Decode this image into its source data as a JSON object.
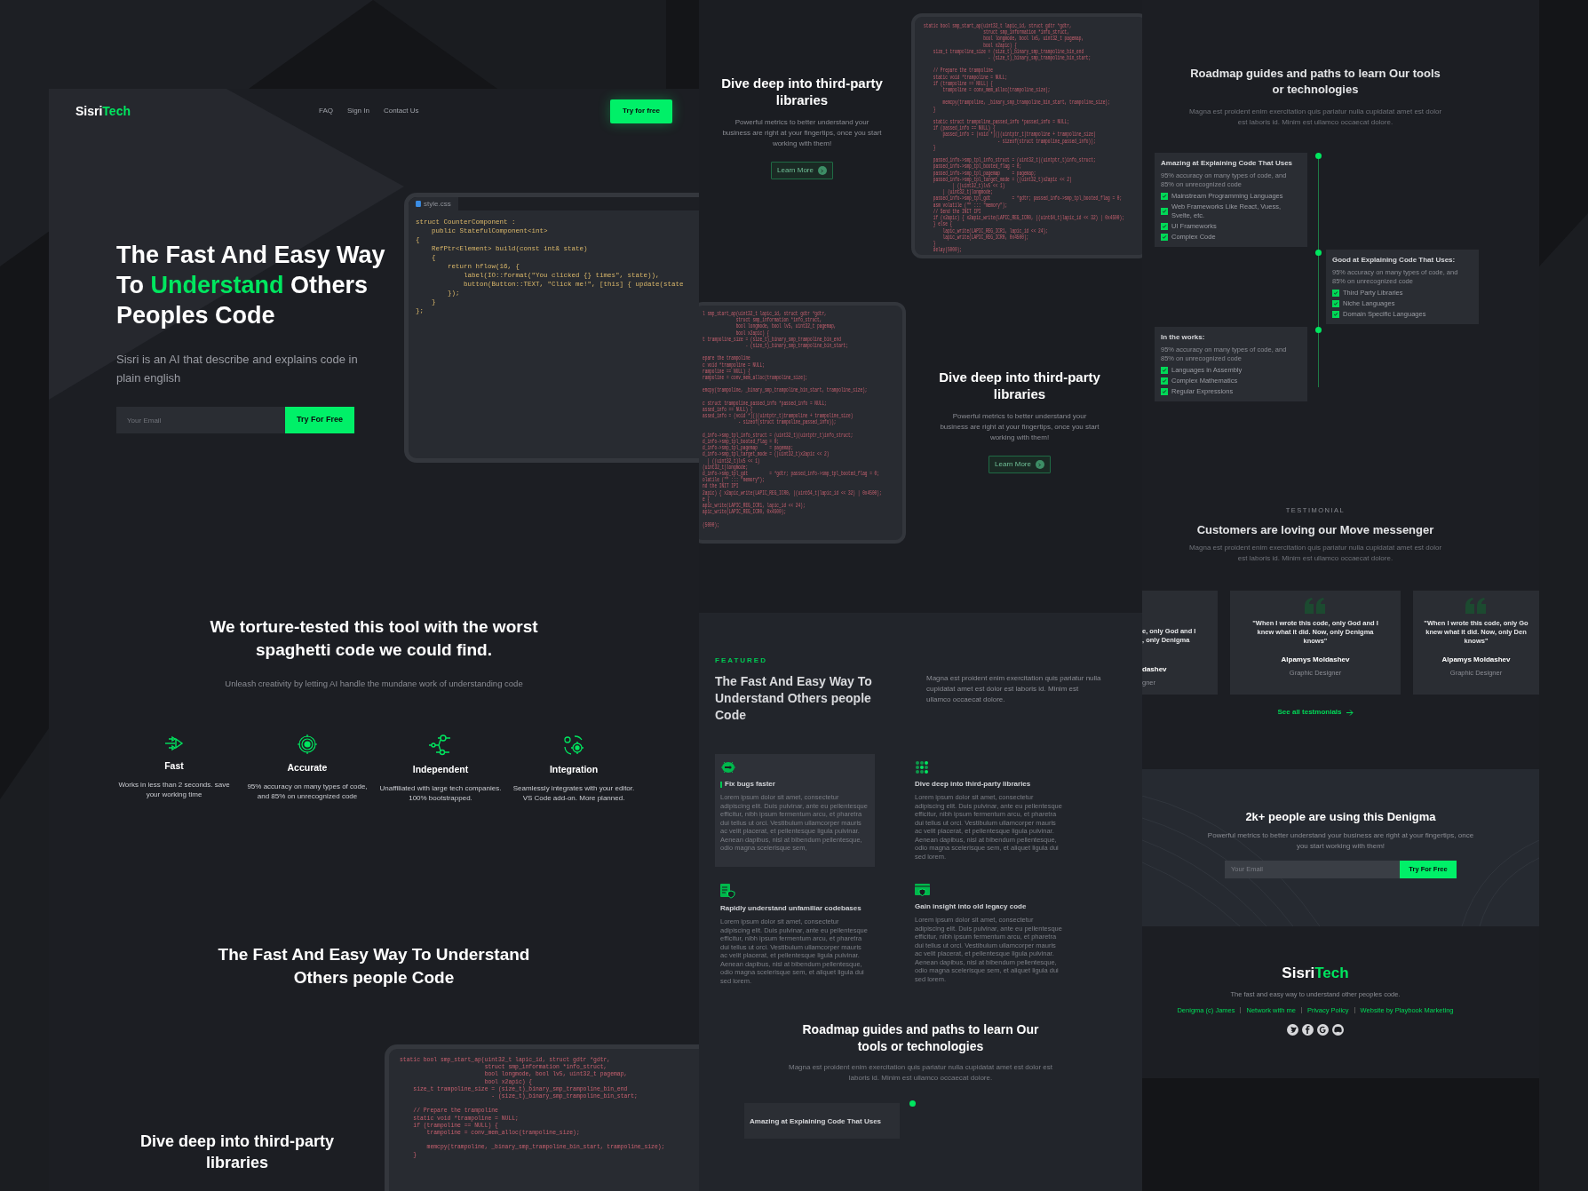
{
  "nav": {
    "logo": [
      {
        "text": "Sisri",
        "accent": false
      },
      {
        "text": "Tech",
        "accent": true
      }
    ],
    "links": [
      "FAQ",
      "Sign In",
      "Contact Us"
    ],
    "cta": "Try for free"
  },
  "hero": {
    "title_lines": [
      [
        {
          "text": "The Fast And Easy Way",
          "accent": false
        }
      ],
      [
        {
          "text": "To ",
          "accent": false
        },
        {
          "text": "Understand",
          "accent": true
        },
        {
          "text": " Others",
          "accent": false
        }
      ],
      [
        {
          "text": "Peoples Code",
          "accent": false
        }
      ]
    ],
    "subtitle": "Sisri is an AI that describe and explains code in plain english",
    "placeholder": "Your Email",
    "button": "Try For Free",
    "editor": {
      "tab": "style.css",
      "code": [
        "struct CounterComponent :",
        "    public StatefulComponent<int>",
        "{",
        "    RefPtr<Element> build(const int& state)",
        "    {",
        "        return hflow(16, {",
        "            label(IO::format(\"You clicked {} times\", state)),",
        "            button(Button::TEXT, \"Click me!\", [this] { update(state",
        "        });",
        "    }",
        "};"
      ]
    }
  },
  "torture": {
    "heading": "We torture-tested this tool with the worst spaghetti code we could find.",
    "subheading": "Unleash creativity by letting AI handle the mundane work of understanding code",
    "features": [
      {
        "kind": "fast",
        "title": "Fast",
        "text": "Works in less than 2 seconds. save your working time"
      },
      {
        "kind": "accurate",
        "title": "Accurate",
        "text": "95% accuracy on many types of code, and 85% on unrecognized code"
      },
      {
        "kind": "independent",
        "title": "Independent",
        "text": "Unaffiliated with large tech companies. 100% bootstrapped."
      },
      {
        "kind": "integration",
        "title": "Integration",
        "text": "Seamlessly integrates with your editor. VS Code add-on. More planned."
      }
    ]
  },
  "way": {
    "heading": "The Fast And Easy Way To Understand Others people Code"
  },
  "dive_left": {
    "heading": "Dive deep into third-party libraries",
    "code_blocks": [
      [
        "static bool smp_start_ap(uint32_t lapic_id, struct gdtr *gdtr,",
        "                         struct smp_information *info_struct,",
        "                         bool longmode, bool lv5, uint32_t pagemap,",
        "                         bool x2apic) {",
        "    size_t trampoline_size = (size_t)_binary_smp_trampoline_bin_end",
        "                           - (size_t)_binary_smp_trampoline_bin_start;"
      ],
      [
        "    // Prepare the trampoline",
        "    static void *trampoline = NULL;",
        "    if (trampoline == NULL) {",
        "        trampoline = conv_mem_alloc(trampoline_size);"
      ],
      [
        "        memcpy(trampoline, _binary_smp_trampoline_bin_start, trampoline_size);",
        "    }"
      ]
    ]
  },
  "middle_sections": [
    {
      "heading": "Dive deep into third-party libraries",
      "text": "Powerful metrics to better understand your business are right at your fingertips, once you start working with them!",
      "button": "Learn More",
      "code_blocks": [
        [
          "static bool smp_start_ap(uint32_t lapic_id, struct gdtr *gdtr,",
          "                         struct smp_information *info_struct,",
          "                         bool longmode, bool lv5, uint32_t pagemap,",
          "                         bool x2apic) {",
          "    size_t trampoline_size = (size_t)_binary_smp_trampoline_bin_end",
          "                           - (size_t)_binary_smp_trampoline_bin_start;"
        ],
        [
          "    // Prepare the trampoline",
          "    static void *trampoline = NULL;",
          "    if (trampoline == NULL) {",
          "        trampoline = conv_mem_alloc(trampoline_size);"
        ],
        [
          "        memcpy(trampoline, _binary_smp_trampoline_bin_start, trampoline_size);",
          "    }"
        ],
        [
          "    static struct trampoline_passed_info *passed_info = NULL;",
          "    if (passed_info == NULL) {",
          "        passed_info = (void *)(((uintptr_t)trampoline + trampoline_size)",
          "                               - sizeof(struct trampoline_passed_info));",
          "    }"
        ],
        [
          "    passed_info->smp_tpl_info_struct = (uint32_t)(uintptr_t)info_struct;",
          "    passed_info->smp_tpl_booted_flag = 0;",
          "    passed_info->smp_tpl_pagemap     = pagemap;",
          "    passed_info->smp_tpl_target_mode = ((uint32_t)x2apic << 2)",
          "            | ((uint32_t)lv5 << 1)",
          "        | (uint32_t)longmode;",
          "    passed_info->smp_tpl_gdt         = *gdtr; passed_info->smp_tpl_booted_flag = 0;",
          "    asm volatile (\"\" ::: \"memory\");",
          "    // Send the INIT IPI",
          "    if (x2apic) { x2apic_write(LAPIC_REG_ICR0, ((uint64_t)lapic_id << 32) | 0x4500);",
          "    } else {",
          "        lapic_write(LAPIC_REG_ICR1, lapic_id << 24);",
          "        lapic_write(LAPIC_REG_ICR0, 0x4500);",
          "    }",
          "    delay(5000);"
        ]
      ]
    },
    {
      "heading": "Dive deep into third-party libraries",
      "text": "Powerful metrics to better understand your business are right at your fingertips, once you start working with them!",
      "button": "Learn More",
      "code_blocks": [
        [
          "l smp_start_ap(uint32_t lapic_id, struct gdtr *gdtr,",
          "              struct smp_information *info_struct,",
          "              bool longmode, bool lv5, uint32_t pagemap,",
          "              bool x2apic) {",
          "t trampoline_size = (size_t)_binary_smp_trampoline_bin_end",
          "                  - (size_t)_binary_smp_trampoline_bin_start;"
        ],
        [
          "epare the trampoline",
          "c void *trampoline = NULL;",
          "rampoline == NULL) {",
          "rampoline = conv_mem_alloc(trampoline_size);"
        ],
        [
          "emcpy(trampoline, _binary_smp_trampoline_bin_start, trampoline_size);"
        ],
        [
          "c struct trampoline_passed_info *passed_info = NULL;",
          "assed_info == NULL) {",
          "assed_info = (void *)(((uintptr_t)trampoline + trampoline_size)",
          "               - sizeof(struct trampoline_passed_info));"
        ],
        [
          "d_info->smp_tpl_info_struct = (uint32_t)(uintptr_t)info_struct;",
          "d_info->smp_tpl_booted_flag = 0;",
          "d_info->smp_tpl_pagemap     = pagemap;",
          "d_info->smp_tpl_target_mode = ((uint32_t)x2apic << 2)",
          "  | ((uint32_t)lv5 << 1)",
          "(uint32_t)longmode;",
          "d_info->smp_tpl_gdt         = *gdtr; passed_info->smp_tpl_booted_flag = 0;",
          "olatile (\"\" ::: \"memory\");",
          "nd the INIT IPI",
          "2apic) { x2apic_write(LAPIC_REG_ICR0, ((uint64_t)lapic_id << 32) | 0x4500);",
          "e {",
          "apic_write(LAPIC_REG_ICR1, lapic_id << 24);",
          "apic_write(LAPIC_REG_ICR0, 0x4500);"
        ],
        [
          "(5000);"
        ]
      ]
    }
  ],
  "featured": {
    "label": "FEATURED",
    "heading": "The Fast And Easy Way To Understand Others people Code",
    "text": "Magna est proident enim exercitation quis pariatur nulla cupidatat amet est dolor est laboris id. Minim est ullamco occaecat dolore.",
    "cards": [
      {
        "kind": "bug",
        "title": "Fix bugs faster",
        "selected": true,
        "text": "Lorem ipsum dolor sit amet, consectetur adipiscing elit. Duis pulvinar, ante eu pellentesque efficitur, nibh ipsum fermentum arcu, et pharetra dui tellus ut orci. Vestibulum ullamcorper mauris ac velit placerat, et pellentesque ligula pulvinar. Aenean dapibus, nisl at bibendum pellentesque, odio magna scelerisque sem,"
      },
      {
        "kind": "grid",
        "title": "Dive deep into third-party libraries",
        "selected": false,
        "text": "Lorem ipsum dolor sit amet, consectetur adipiscing elit. Duis pulvinar, ante eu pellentesque efficitur, nibh ipsum fermentum arcu, et pharetra dui tellus ut orci. Vestibulum ullamcorper mauris ac velit placerat, et pellentesque ligula pulvinar. Aenean dapibus, nisl at bibendum pellentesque, odio magna scelerisque sem, et aliquet ligula dui sed lorem."
      },
      {
        "kind": "document",
        "title": "Rapidly understand unfamiliar codebases",
        "selected": false,
        "text": "Lorem ipsum dolor sit amet, consectetur adipiscing elit. Duis pulvinar, ante eu pellentesque efficitur, nibh ipsum fermentum arcu, et pharetra dui tellus ut orci. Vestibulum ullamcorper mauris ac velit placerat, et pellentesque ligula pulvinar. Aenean dapibus, nisl at bibendum pellentesque, odio magna scelerisque sem, et aliquet ligula dui sed lorem."
      },
      {
        "kind": "browser",
        "title": "Gain insight into old legacy code",
        "selected": false,
        "text": "Lorem ipsum dolor sit amet, consectetur adipiscing elit. Duis pulvinar, ante eu pellentesque efficitur, nibh ipsum fermentum arcu, et pharetra dui tellus ut orci. Vestibulum ullamcorper mauris ac velit placerat, et pellentesque ligula pulvinar. Aenean dapibus, nisl at bibendum pellentesque, odio magna scelerisque sem, et aliquet ligula dui sed lorem."
      }
    ]
  },
  "roadmap_preview": {
    "heading": "Roadmap guides and paths to learn Our tools or technologies",
    "text": "Magna est proident enim exercitation quis pariatur nulla cupidatat amet est dolor est laboris id. Minim est ullamco occaecat dolore.",
    "card_title": "Amazing at Explaining Code That Uses"
  },
  "roadmap": {
    "heading": "Roadmap guides and paths to learn Our tools or technologies",
    "text": "Magna est proident enim exercitation quis pariatur nulla cupidatat amet est dolor est laboris id. Minim est ullamco occaecat dolore.",
    "steps": [
      {
        "title": "Amazing at Explaining Code That Uses",
        "text": "95% accuracy on many types of code, and 85% on unrecognized code",
        "items": [
          {
            "label": "Mainstream Programming Languages",
            "checked": true
          },
          {
            "label": "Web Frameworks Like React, Vuess, Svelte, etc.",
            "checked": true
          },
          {
            "label": "UI Frameworks",
            "checked": true
          },
          {
            "label": "Complex Code",
            "checked": true
          }
        ]
      },
      {
        "title": "Good at Explaining Code That Uses:",
        "text": "95% accuracy on many types of code, and 85% on unrecognized code",
        "items": [
          {
            "label": "Third Party Libraries",
            "checked": true
          },
          {
            "label": "Niche Languages",
            "checked": true
          },
          {
            "label": "Domain Specific Languages",
            "checked": true
          }
        ]
      },
      {
        "title": "In the works:",
        "text": "95% accuracy on many types of code, and 85% on unrecognized code",
        "items": [
          {
            "label": "Languages in Assembly",
            "checked": true
          },
          {
            "label": "Complex Mathematics",
            "checked": true
          },
          {
            "label": "Regular Expressions",
            "checked": true
          }
        ]
      }
    ]
  },
  "testimonials": {
    "label": "TESTIMONIAL",
    "heading": "Customers are loving our Move messenger",
    "text": "Magna est proident enim exercitation quis pariatur nulla cupidatat amet est dolor est laboris id. Minim est ullamco occaecat dolore.",
    "cards": [
      {
        "kind": "cut_left",
        "quote": [
          "e, only God and I",
          ", only Denigma"
        ],
        "name": "dashev",
        "role": "gner"
      },
      {
        "kind": "full",
        "quote": [
          "\"When I wrote this code, only God and I",
          "knew what it did. Now, only Denigma",
          "knows\""
        ],
        "name": "Alpamys Moldashev",
        "role": "Graphic Designer"
      },
      {
        "kind": "cut_right",
        "quote": [
          "\"When I wrote this code, only Go",
          "knew what it did. Now, only Den",
          "knows\""
        ],
        "name": "Alpamys Moldashev",
        "role": "Graphic Designer"
      }
    ],
    "link": "See all testmonials"
  },
  "cta": {
    "heading": "2k+ people are using this Denigma",
    "text": "Powerful metrics to better understand your business are right at your fingertips, once you start working with them!",
    "placeholder": "Your Email",
    "button": "Try For Free"
  },
  "footer": {
    "logo": [
      {
        "text": "Sisri",
        "accent": false
      },
      {
        "text": "Tech",
        "accent": true
      }
    ],
    "tagline": "The fast and easy way to understand other peoples code.",
    "links": [
      "Denigma (c) James",
      "Network with me",
      "Privacy Policy",
      "Website by Playbook Marketing"
    ],
    "socials": [
      {
        "kind": "bird"
      },
      {
        "kind": "f"
      },
      {
        "kind": "g"
      },
      {
        "kind": "chat"
      }
    ]
  }
}
